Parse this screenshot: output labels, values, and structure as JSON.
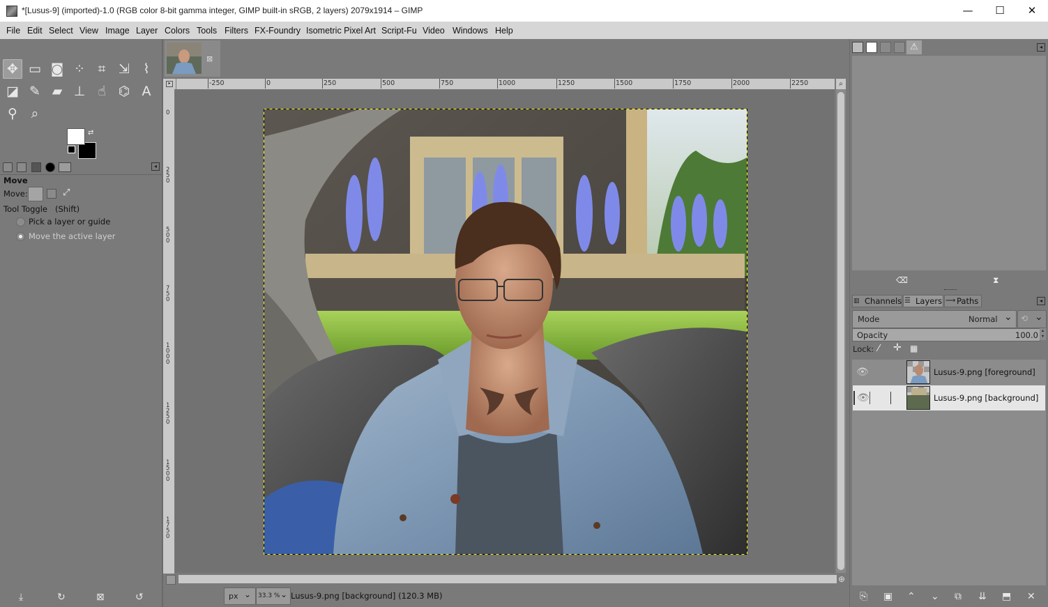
{
  "window": {
    "title": "*[Lusus-9] (imported)-1.0 (RGB color 8-bit gamma integer, GIMP built-in sRGB, 2 layers) 2079x1914 – GIMP",
    "minimize": "—",
    "maximize": "☐",
    "close": "✕"
  },
  "menubar": [
    "File",
    "Edit",
    "Select",
    "View",
    "Image",
    "Layer",
    "Colors",
    "Tools",
    "Filters",
    "FX-Foundry",
    "Isometric Pixel Art",
    "Script-Fu",
    "Video",
    "Windows",
    "Help"
  ],
  "tools": {
    "rows": [
      [
        "move-tool-icon",
        "rect-select-tool-icon",
        "fuzzy-select-tool-icon",
        "foreground-select-tool-icon",
        "crop-tool-icon",
        "unified-transform-tool-icon",
        "warp-transform-tool-icon"
      ],
      [
        "bucket-fill-tool-icon",
        "paintbrush-tool-icon",
        "eraser-tool-icon",
        "clone-tool-icon",
        "smudge-tool-icon",
        "paths-tool-icon",
        "text-tool-icon"
      ],
      [
        "color-picker-tool-icon",
        "zoom-tool-icon"
      ]
    ],
    "glyphs": {
      "move-tool-icon": "✥",
      "rect-select-tool-icon": "▭",
      "fuzzy-select-tool-icon": "◙",
      "foreground-select-tool-icon": "⁘",
      "crop-tool-icon": "⌗",
      "unified-transform-tool-icon": "⇲",
      "warp-transform-tool-icon": "⌇",
      "bucket-fill-tool-icon": "◪",
      "paintbrush-tool-icon": "✎",
      "eraser-tool-icon": "▰",
      "clone-tool-icon": "⊥",
      "smudge-tool-icon": "☝",
      "paths-tool-icon": "⌬",
      "text-tool-icon": "A",
      "color-picker-tool-icon": "⚲",
      "zoom-tool-icon": "⌕"
    }
  },
  "colors": {
    "foreground": "#ffffff",
    "background": "#000000"
  },
  "tool_options": {
    "title": "Move",
    "move_label": "Move:",
    "toggle_label": "Tool Toggle",
    "toggle_key": "(Shift)",
    "option_pick": "Pick a layer or guide",
    "option_move": "Move the active layer",
    "selected_option": "Move the active layer"
  },
  "ruler_top": [
    "-250",
    "0",
    "250",
    "500",
    "750",
    "1000",
    "1250",
    "1500",
    "1750",
    "2000",
    "2250"
  ],
  "ruler_left": [
    "0",
    "2\n5\n0",
    "5\n0\n0",
    "7\n5\n0",
    "1\n0\n0\n0",
    "1\n2\n5\n0",
    "1\n5\n0\n0",
    "1\n7\n5\n0"
  ],
  "status": {
    "unit": "px",
    "zoom": "33.3 %",
    "message": "Lusus-9.png [background] (120.3 MB)"
  },
  "dock": {
    "tabs": [
      "Channels",
      "Layers",
      "Paths"
    ],
    "active_tab": "Layers",
    "mode_label": "Mode",
    "mode_value": "Normal",
    "opacity_label": "Opacity",
    "opacity_value": "100.0",
    "lock_label": "Lock:"
  },
  "layers": [
    {
      "name": "Lusus-9.png [foreground]",
      "visible": true,
      "selected": false
    },
    {
      "name": "Lusus-9.png [background]",
      "visible": true,
      "selected": true
    }
  ],
  "accent": {
    "selection_marching": "#f0f000",
    "canvas_bg": "#727272"
  }
}
